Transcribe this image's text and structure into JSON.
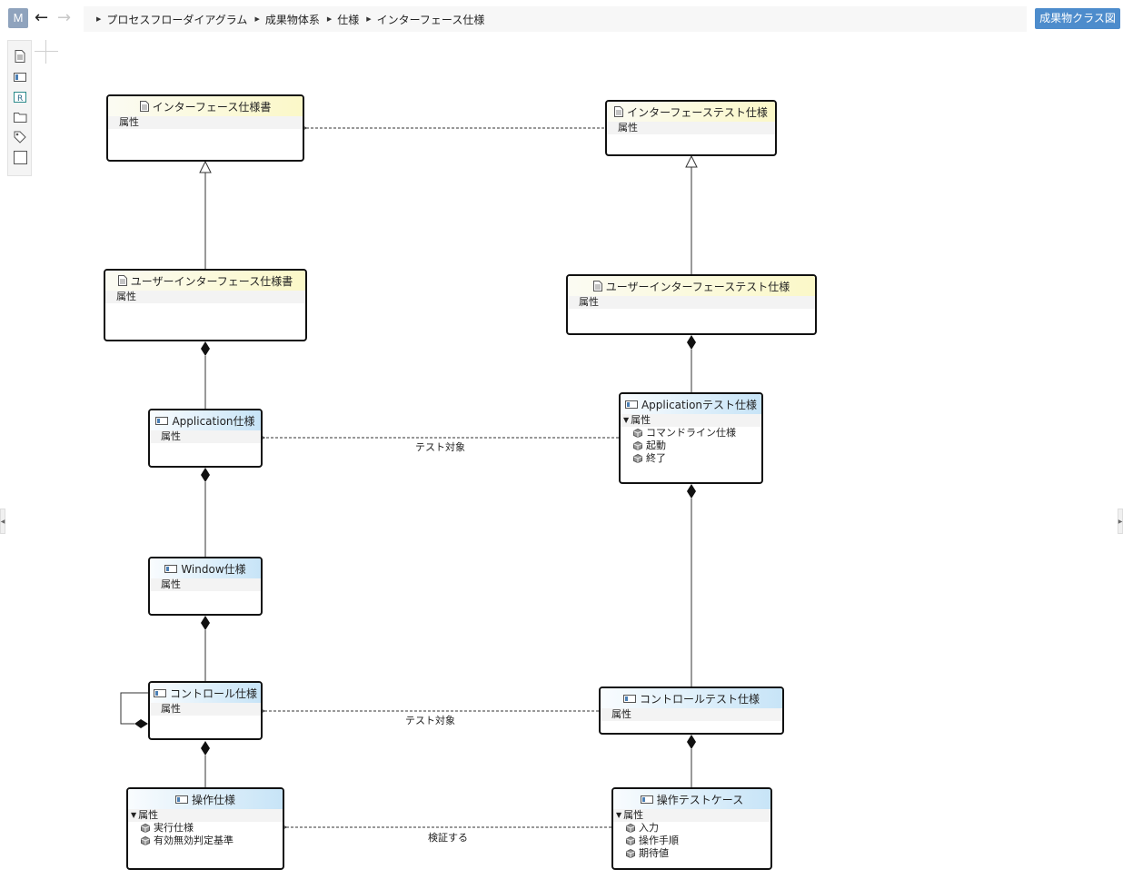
{
  "topbar": {
    "m_label": "M",
    "breadcrumb": [
      "プロセスフローダイアグラム",
      "成果物体系",
      "仕様",
      "インターフェース仕様"
    ],
    "right_button": "成果物クラス図"
  },
  "toolbar": {
    "tools": [
      "document-icon",
      "class-icon",
      "requirement-icon",
      "folder-icon",
      "tag-icon",
      "rectangle-icon"
    ],
    "requirement_letter": "R"
  },
  "diagram": {
    "nodes": {
      "if_spec": {
        "title": "インターフェース仕様書",
        "attr": "属性"
      },
      "if_test": {
        "title": "インターフェーステスト仕様",
        "attr": "属性"
      },
      "ui_spec": {
        "title": "ユーザーインターフェース仕様書",
        "attr": "属性"
      },
      "ui_test": {
        "title": "ユーザーインターフェーステスト仕様",
        "attr": "属性"
      },
      "app_spec": {
        "title": "Application仕様",
        "attr": "属性"
      },
      "app_test": {
        "title": "Applicationテスト仕様",
        "attr": "属性",
        "items": [
          "コマンドライン仕様",
          "起動",
          "終了"
        ]
      },
      "win_spec": {
        "title": "Window仕様",
        "attr": "属性"
      },
      "ctrl_spec": {
        "title": "コントロール仕様",
        "attr": "属性"
      },
      "ctrl_test": {
        "title": "コントロールテスト仕様",
        "attr": "属性"
      },
      "op_spec": {
        "title": "操作仕様",
        "attr": "属性",
        "items": [
          "実行仕様",
          "有効無効判定基準"
        ]
      },
      "op_test": {
        "title": "操作テストケース",
        "attr": "属性",
        "items": [
          "入力",
          "操作手順",
          "期待値"
        ]
      }
    },
    "edge_labels": {
      "app": "テスト対象",
      "ctrl": "テスト対象",
      "op": "検証する"
    }
  },
  "colors": {
    "doc_header": "#fbf8c8",
    "class_header": "#c7e4f7",
    "accent_button": "#4d8ccc",
    "m_button": "#8fa3bd"
  }
}
